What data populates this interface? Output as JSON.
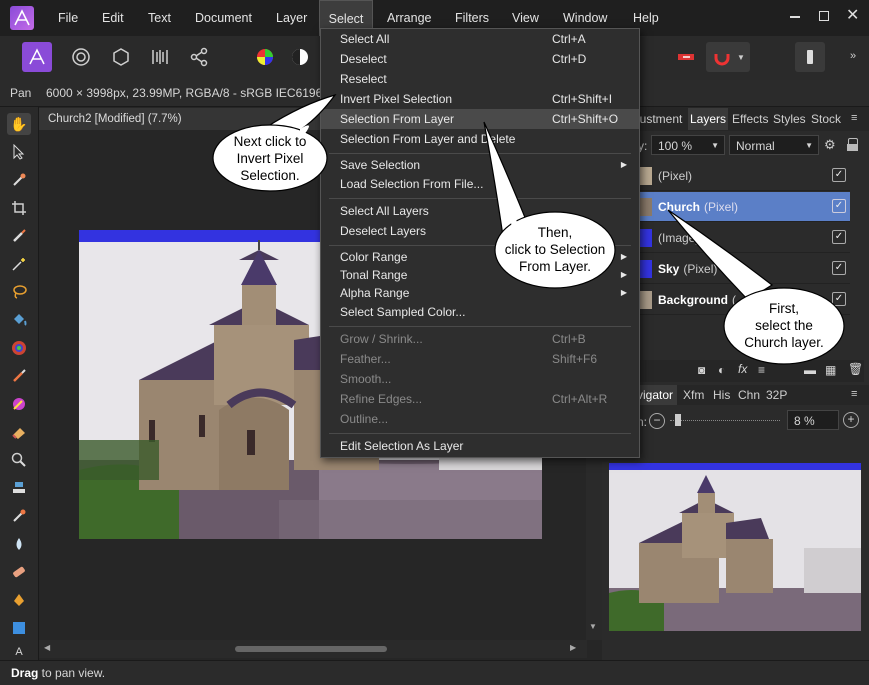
{
  "menubar": {
    "items": [
      "File",
      "Edit",
      "Text",
      "Document",
      "Layer",
      "Select",
      "Arrange",
      "Filters",
      "View",
      "Window",
      "Help"
    ],
    "active": "Select"
  },
  "context": {
    "tool": "Pan",
    "info": "6000 × 3998px, 23.99MP, RGBA/8 - sRGB IEC61966-"
  },
  "document": {
    "tab_title": "Church2 [Modified] (7.7%)"
  },
  "select_menu": {
    "items": [
      {
        "label": "Select All",
        "shortcut": "Ctrl+A"
      },
      {
        "label": "Deselect",
        "shortcut": "Ctrl+D"
      },
      {
        "label": "Reselect",
        "shortcut": ""
      },
      {
        "label": "Invert Pixel Selection",
        "shortcut": "Ctrl+Shift+I"
      },
      {
        "label": "Selection From Layer",
        "shortcut": "Ctrl+Shift+O"
      },
      {
        "label": "Selection From Layer and Delete",
        "shortcut": ""
      },
      {
        "label": "Save Selection",
        "shortcut": ""
      },
      {
        "label": "Load Selection From File...",
        "shortcut": ""
      },
      {
        "label": "Select All Layers",
        "shortcut": ""
      },
      {
        "label": "Deselect Layers",
        "shortcut": ""
      },
      {
        "label": "Color Range",
        "shortcut": ""
      },
      {
        "label": "Tonal Range",
        "shortcut": ""
      },
      {
        "label": "Alpha Range",
        "shortcut": ""
      },
      {
        "label": "Select Sampled Color...",
        "shortcut": ""
      },
      {
        "label": "Grow / Shrink...",
        "shortcut": "Ctrl+B"
      },
      {
        "label": "Feather...",
        "shortcut": "Shift+F6"
      },
      {
        "label": "Smooth...",
        "shortcut": ""
      },
      {
        "label": "Refine Edges...",
        "shortcut": "Ctrl+Alt+R"
      },
      {
        "label": "Outline...",
        "shortcut": ""
      },
      {
        "label": "Edit Selection As Layer",
        "shortcut": ""
      }
    ]
  },
  "layers_panel": {
    "tabs": [
      "justment",
      "Layers",
      "Effects",
      "Styles",
      "Stock"
    ],
    "opacity_label": "y:",
    "opacity": "100 %",
    "blend_mode": "Normal",
    "layers": [
      {
        "name": "",
        "type": "(Pixel)"
      },
      {
        "name": "Church",
        "type": "(Pixel)"
      },
      {
        "name": "",
        "type": "(Image)"
      },
      {
        "name": "Sky",
        "type": "(Pixel)"
      },
      {
        "name": "Background",
        "type": "("
      }
    ]
  },
  "navigator_panel": {
    "tabs": [
      "vigator",
      "Xfm",
      "His",
      "Chn",
      "32P"
    ],
    "zoom_label": "n:",
    "zoom_value": "8 %"
  },
  "callouts": {
    "first": "First,\nselect the\nChurch layer.",
    "then": "Then,\nclick to Selection\nFrom Layer.",
    "next": "Next click to\nInvert Pixel\nSelection."
  },
  "status": {
    "bold": "Drag",
    "rest": " to pan view."
  },
  "colors": {
    "accent_selected_layer": "#5b7fc7",
    "menu_highlight": "#4a4a4a",
    "sky_band": "#3333e0"
  }
}
